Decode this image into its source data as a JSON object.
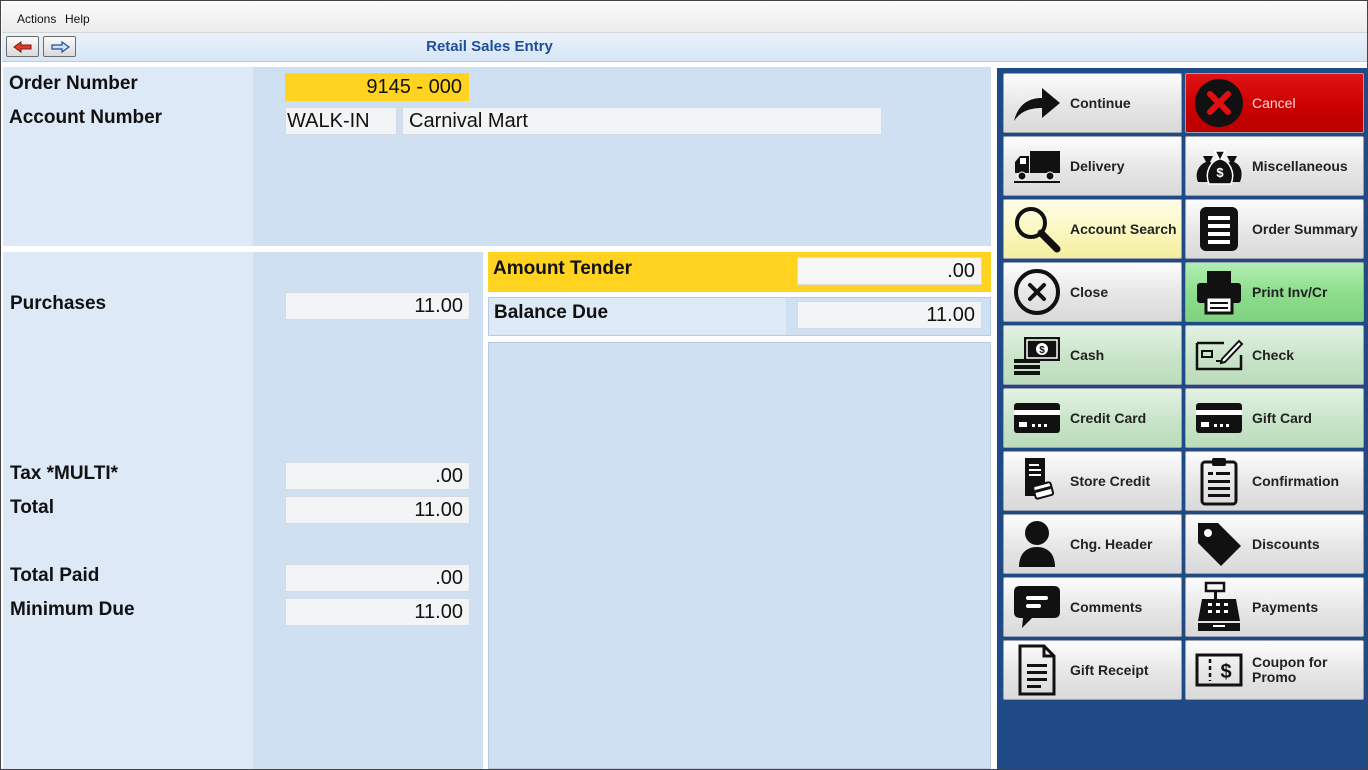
{
  "menu": {
    "actions": "Actions",
    "help": "Help"
  },
  "window_title": "Retail Sales Entry",
  "header": {
    "order_number_label": "Order Number",
    "order_number_value": "9145 - 000",
    "account_number_label": "Account Number",
    "account_code": "WALK-IN",
    "account_name": "Carnival Mart"
  },
  "totals": {
    "purchases_label": "Purchases",
    "purchases_value": "11.00",
    "tax_label": "Tax *MULTI*",
    "tax_value": ".00",
    "total_label": "Total",
    "total_value": "11.00",
    "total_paid_label": "Total Paid",
    "total_paid_value": ".00",
    "minimum_due_label": "Minimum Due",
    "minimum_due_value": "11.00"
  },
  "tender": {
    "amount_tender_label": "Amount Tender",
    "amount_tender_value": ".00",
    "balance_due_label": "Balance Due",
    "balance_due_value": "11.00"
  },
  "actions": [
    {
      "label": "Continue",
      "icon": "arrow-right-icon"
    },
    {
      "label": "Cancel",
      "icon": "x-circle-icon"
    },
    {
      "label": "Delivery",
      "icon": "truck-icon"
    },
    {
      "label": "Miscellaneous",
      "icon": "money-bags-icon"
    },
    {
      "label": "Account Search",
      "icon": "magnifier-icon"
    },
    {
      "label": "Order Summary",
      "icon": "list-icon"
    },
    {
      "label": "Close",
      "icon": "close-circle-icon"
    },
    {
      "label": "Print Inv/Cr",
      "icon": "printer-icon"
    },
    {
      "label": "Cash",
      "icon": "cash-icon"
    },
    {
      "label": "Check",
      "icon": "check-icon"
    },
    {
      "label": "Credit Card",
      "icon": "credit-card-icon"
    },
    {
      "label": "Gift Card",
      "icon": "gift-card-icon"
    },
    {
      "label": "Store Credit",
      "icon": "store-credit-icon"
    },
    {
      "label": "Confirmation",
      "icon": "clipboard-icon"
    },
    {
      "label": "Chg. Header",
      "icon": "person-icon"
    },
    {
      "label": "Discounts",
      "icon": "tag-icon"
    },
    {
      "label": "Comments",
      "icon": "speech-bubble-icon"
    },
    {
      "label": "Payments",
      "icon": "cash-register-icon"
    },
    {
      "label": "Gift Receipt",
      "icon": "document-icon"
    },
    {
      "label": "Coupon for Promo",
      "icon": "coupon-icon"
    }
  ],
  "colors": {
    "highlight_yellow": "#ffd320",
    "panel_blue": "#cfe0f3",
    "sidebar_navy": "#1f4a85",
    "cancel_red": "#cc0000",
    "title_blue": "#1f4e9a"
  }
}
